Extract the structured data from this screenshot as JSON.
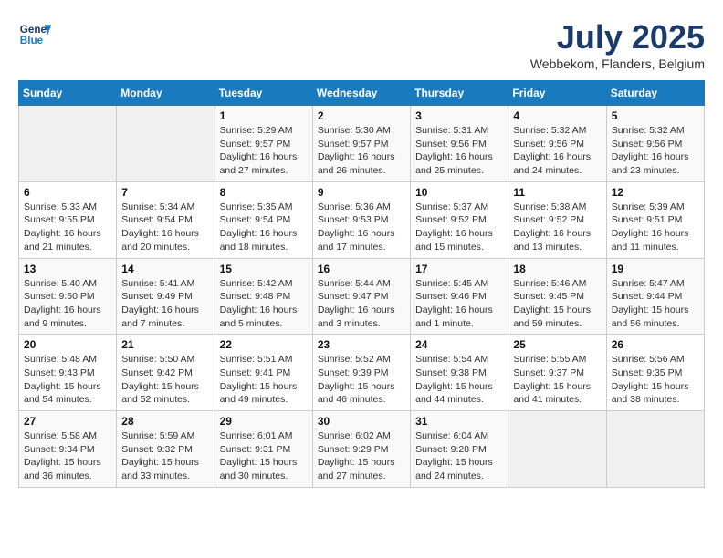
{
  "header": {
    "logo_line1": "General",
    "logo_line2": "Blue",
    "title": "July 2025",
    "subtitle": "Webbekom, Flanders, Belgium"
  },
  "weekdays": [
    "Sunday",
    "Monday",
    "Tuesday",
    "Wednesday",
    "Thursday",
    "Friday",
    "Saturday"
  ],
  "weeks": [
    [
      {
        "day": "",
        "info": ""
      },
      {
        "day": "",
        "info": ""
      },
      {
        "day": "1",
        "info": "Sunrise: 5:29 AM\nSunset: 9:57 PM\nDaylight: 16 hours and 27 minutes."
      },
      {
        "day": "2",
        "info": "Sunrise: 5:30 AM\nSunset: 9:57 PM\nDaylight: 16 hours and 26 minutes."
      },
      {
        "day": "3",
        "info": "Sunrise: 5:31 AM\nSunset: 9:56 PM\nDaylight: 16 hours and 25 minutes."
      },
      {
        "day": "4",
        "info": "Sunrise: 5:32 AM\nSunset: 9:56 PM\nDaylight: 16 hours and 24 minutes."
      },
      {
        "day": "5",
        "info": "Sunrise: 5:32 AM\nSunset: 9:56 PM\nDaylight: 16 hours and 23 minutes."
      }
    ],
    [
      {
        "day": "6",
        "info": "Sunrise: 5:33 AM\nSunset: 9:55 PM\nDaylight: 16 hours and 21 minutes."
      },
      {
        "day": "7",
        "info": "Sunrise: 5:34 AM\nSunset: 9:54 PM\nDaylight: 16 hours and 20 minutes."
      },
      {
        "day": "8",
        "info": "Sunrise: 5:35 AM\nSunset: 9:54 PM\nDaylight: 16 hours and 18 minutes."
      },
      {
        "day": "9",
        "info": "Sunrise: 5:36 AM\nSunset: 9:53 PM\nDaylight: 16 hours and 17 minutes."
      },
      {
        "day": "10",
        "info": "Sunrise: 5:37 AM\nSunset: 9:52 PM\nDaylight: 16 hours and 15 minutes."
      },
      {
        "day": "11",
        "info": "Sunrise: 5:38 AM\nSunset: 9:52 PM\nDaylight: 16 hours and 13 minutes."
      },
      {
        "day": "12",
        "info": "Sunrise: 5:39 AM\nSunset: 9:51 PM\nDaylight: 16 hours and 11 minutes."
      }
    ],
    [
      {
        "day": "13",
        "info": "Sunrise: 5:40 AM\nSunset: 9:50 PM\nDaylight: 16 hours and 9 minutes."
      },
      {
        "day": "14",
        "info": "Sunrise: 5:41 AM\nSunset: 9:49 PM\nDaylight: 16 hours and 7 minutes."
      },
      {
        "day": "15",
        "info": "Sunrise: 5:42 AM\nSunset: 9:48 PM\nDaylight: 16 hours and 5 minutes."
      },
      {
        "day": "16",
        "info": "Sunrise: 5:44 AM\nSunset: 9:47 PM\nDaylight: 16 hours and 3 minutes."
      },
      {
        "day": "17",
        "info": "Sunrise: 5:45 AM\nSunset: 9:46 PM\nDaylight: 16 hours and 1 minute."
      },
      {
        "day": "18",
        "info": "Sunrise: 5:46 AM\nSunset: 9:45 PM\nDaylight: 15 hours and 59 minutes."
      },
      {
        "day": "19",
        "info": "Sunrise: 5:47 AM\nSunset: 9:44 PM\nDaylight: 15 hours and 56 minutes."
      }
    ],
    [
      {
        "day": "20",
        "info": "Sunrise: 5:48 AM\nSunset: 9:43 PM\nDaylight: 15 hours and 54 minutes."
      },
      {
        "day": "21",
        "info": "Sunrise: 5:50 AM\nSunset: 9:42 PM\nDaylight: 15 hours and 52 minutes."
      },
      {
        "day": "22",
        "info": "Sunrise: 5:51 AM\nSunset: 9:41 PM\nDaylight: 15 hours and 49 minutes."
      },
      {
        "day": "23",
        "info": "Sunrise: 5:52 AM\nSunset: 9:39 PM\nDaylight: 15 hours and 46 minutes."
      },
      {
        "day": "24",
        "info": "Sunrise: 5:54 AM\nSunset: 9:38 PM\nDaylight: 15 hours and 44 minutes."
      },
      {
        "day": "25",
        "info": "Sunrise: 5:55 AM\nSunset: 9:37 PM\nDaylight: 15 hours and 41 minutes."
      },
      {
        "day": "26",
        "info": "Sunrise: 5:56 AM\nSunset: 9:35 PM\nDaylight: 15 hours and 38 minutes."
      }
    ],
    [
      {
        "day": "27",
        "info": "Sunrise: 5:58 AM\nSunset: 9:34 PM\nDaylight: 15 hours and 36 minutes."
      },
      {
        "day": "28",
        "info": "Sunrise: 5:59 AM\nSunset: 9:32 PM\nDaylight: 15 hours and 33 minutes."
      },
      {
        "day": "29",
        "info": "Sunrise: 6:01 AM\nSunset: 9:31 PM\nDaylight: 15 hours and 30 minutes."
      },
      {
        "day": "30",
        "info": "Sunrise: 6:02 AM\nSunset: 9:29 PM\nDaylight: 15 hours and 27 minutes."
      },
      {
        "day": "31",
        "info": "Sunrise: 6:04 AM\nSunset: 9:28 PM\nDaylight: 15 hours and 24 minutes."
      },
      {
        "day": "",
        "info": ""
      },
      {
        "day": "",
        "info": ""
      }
    ]
  ]
}
